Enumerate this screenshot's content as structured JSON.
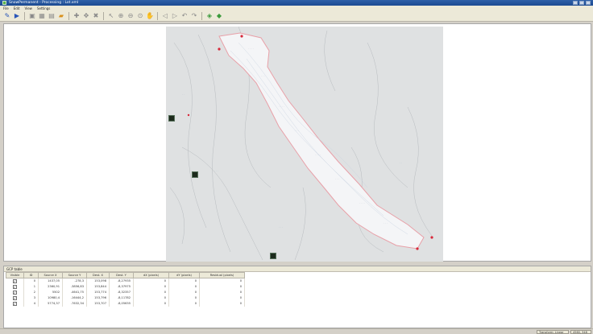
{
  "window": {
    "title": "SnowPermanent - Processing : Lot.xml"
  },
  "menu": {
    "items": [
      {
        "label": "File"
      },
      {
        "label": "Edit"
      },
      {
        "label": "View"
      },
      {
        "label": "Settings"
      }
    ]
  },
  "toolbar": {
    "icons": [
      {
        "name": "edit-icon",
        "glyph": "✎",
        "color": "blue"
      },
      {
        "name": "run-icon",
        "glyph": "▶",
        "color": "blue"
      },
      {
        "name": "save-icon",
        "glyph": "▣",
        "color": "gray"
      },
      {
        "name": "grid-icon",
        "glyph": "▦",
        "color": "gray"
      },
      {
        "name": "grid-settings-icon",
        "glyph": "▤",
        "color": "gray"
      },
      {
        "name": "folder-icon",
        "glyph": "▰",
        "color": "orange"
      },
      {
        "name": "add-point-icon",
        "glyph": "✚",
        "color": "gray"
      },
      {
        "name": "move-point-icon",
        "glyph": "✥",
        "color": "gray"
      },
      {
        "name": "delete-point-icon",
        "glyph": "✖",
        "color": "gray"
      },
      {
        "name": "pointer-icon",
        "glyph": "↖",
        "color": "gray"
      },
      {
        "name": "zoom-in-icon",
        "glyph": "⊕",
        "color": "gray"
      },
      {
        "name": "zoom-out-icon",
        "glyph": "⊖",
        "color": "gray"
      },
      {
        "name": "zoom-extent-icon",
        "glyph": "⊙",
        "color": "gray"
      },
      {
        "name": "pan-icon",
        "glyph": "✋",
        "color": "gray"
      },
      {
        "name": "zoom-previous-icon",
        "glyph": "◁",
        "color": "gray"
      },
      {
        "name": "zoom-next-icon",
        "glyph": "▷",
        "color": "gray"
      },
      {
        "name": "undo-icon",
        "glyph": "↶",
        "color": "gray"
      },
      {
        "name": "redo-icon",
        "glyph": "↷",
        "color": "gray"
      },
      {
        "name": "layer-add-icon",
        "glyph": "◈",
        "color": "green"
      },
      {
        "name": "layer-icon",
        "glyph": "◆",
        "color": "green"
      }
    ]
  },
  "table": {
    "title": "GCP table",
    "columns": [
      "Visible",
      "ID",
      "Source X",
      "Source Y",
      "Dest. X",
      "Dest. Y",
      "dX (pixels)",
      "dY (pixels)",
      "Residual (pixels)"
    ],
    "rows": [
      {
        "visible": "✓",
        "id": "0",
        "source_x": "1437,05",
        "source_y": "-278,3",
        "dest_x": "153,098",
        "dest_y": "-8,27935",
        "dx": "0",
        "dy": "0",
        "residual": "0"
      },
      {
        "visible": "✓",
        "id": "1",
        "source_x": "2360,91",
        "source_y": "-3856,83",
        "dest_x": "153,844",
        "dest_y": "-8,37975",
        "dx": "0",
        "dy": "0",
        "residual": "0"
      },
      {
        "visible": "✓",
        "id": "2",
        "source_x": "5502",
        "source_y": "-4641,75",
        "dest_x": "153,774",
        "dest_y": "-8,32357",
        "dx": "0",
        "dy": "0",
        "residual": "0"
      },
      {
        "visible": "✓",
        "id": "3",
        "source_x": "10980,4",
        "source_y": "-16444,2",
        "dest_x": "153,796",
        "dest_y": "-8,11782",
        "dx": "0",
        "dy": "0",
        "residual": "0"
      },
      {
        "visible": "✓",
        "id": "4",
        "source_x": "5774,37",
        "source_y": "-7632,34",
        "dest_x": "153,707",
        "dest_y": "-8,05635",
        "dx": "0",
        "dy": "0",
        "residual": "0"
      }
    ]
  },
  "statusbar": {
    "transform": "Transform: Linear",
    "coordinate": "4560, 348"
  },
  "map": {
    "outline_color": "#e0505a",
    "symbol_color": "#1c2a1c"
  }
}
